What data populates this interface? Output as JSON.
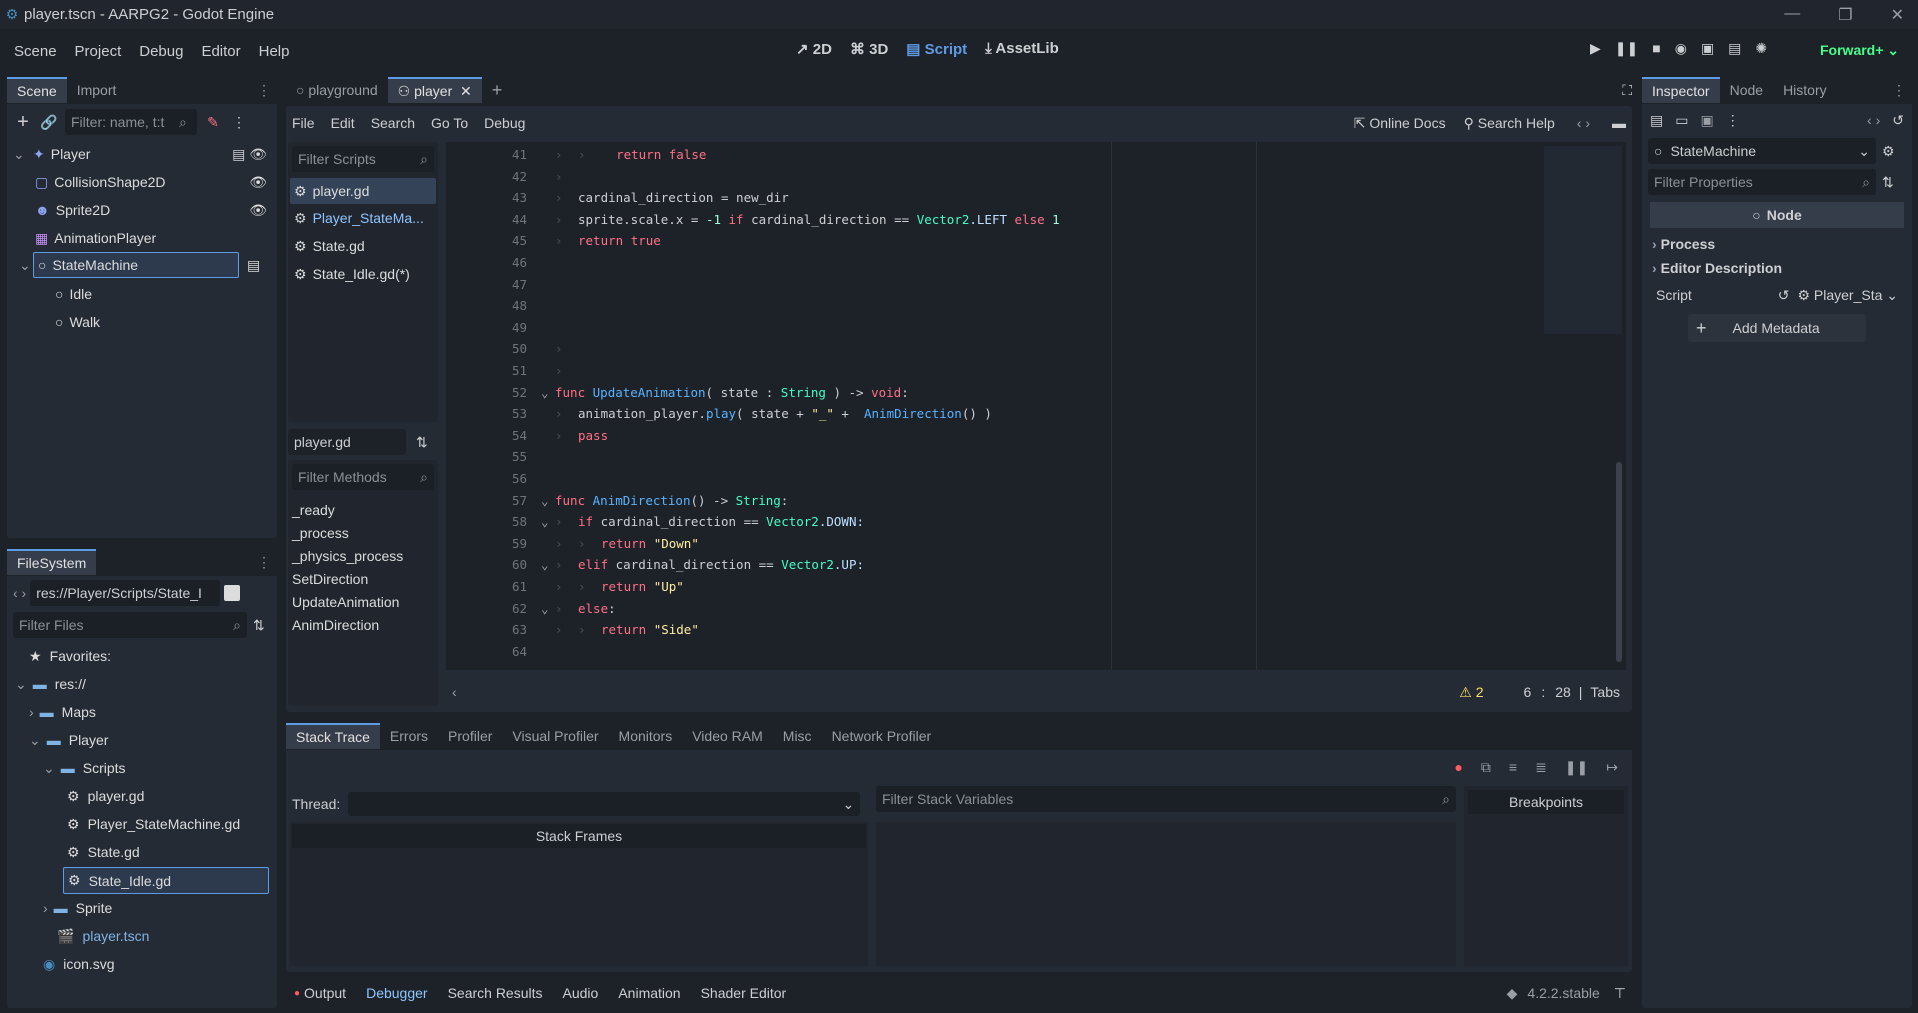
{
  "window": {
    "title": "player.tscn - AARPG2 - Godot Engine"
  },
  "menu": {
    "items": [
      "Scene",
      "Project",
      "Debug",
      "Editor",
      "Help"
    ]
  },
  "workspaces": {
    "items": [
      "2D",
      "3D",
      "Script",
      "AssetLib"
    ],
    "active": "Script"
  },
  "renderer": "Forward+",
  "scene_panel": {
    "tabs": [
      "Scene",
      "Import"
    ],
    "filter_placeholder": "Filter: name, t:t",
    "nodes": [
      {
        "label": "Player",
        "depth": 0
      },
      {
        "label": "CollisionShape2D",
        "depth": 1
      },
      {
        "label": "Sprite2D",
        "depth": 1
      },
      {
        "label": "AnimationPlayer",
        "depth": 1
      },
      {
        "label": "StateMachine",
        "depth": 1
      },
      {
        "label": "Idle",
        "depth": 2
      },
      {
        "label": "Walk",
        "depth": 2
      }
    ]
  },
  "filesystem": {
    "tab": "FileSystem",
    "path": "res://Player/Scripts/State_I",
    "filter_placeholder": "Filter Files",
    "items": [
      {
        "label": "Favorites:",
        "depth": 0
      },
      {
        "label": "res://",
        "depth": 0
      },
      {
        "label": "Maps",
        "depth": 1
      },
      {
        "label": "Player",
        "depth": 1
      },
      {
        "label": "Scripts",
        "depth": 2
      },
      {
        "label": "player.gd",
        "depth": 3
      },
      {
        "label": "Player_StateMachine.gd",
        "depth": 3
      },
      {
        "label": "State.gd",
        "depth": 3
      },
      {
        "label": "State_Idle.gd",
        "depth": 3
      },
      {
        "label": "Sprite",
        "depth": 2
      },
      {
        "label": "player.tscn",
        "depth": 2
      },
      {
        "label": "icon.svg",
        "depth": 1
      }
    ]
  },
  "editor_tabs": {
    "items": [
      "playground",
      "player"
    ],
    "active": "player"
  },
  "script_menu": {
    "items": [
      "File",
      "Edit",
      "Search",
      "Go To",
      "Debug"
    ],
    "online_docs": "Online Docs",
    "search_help": "Search Help"
  },
  "scripts_list": {
    "filter_placeholder": "Filter Scripts",
    "items": [
      "player.gd",
      "Player_StateMa...",
      "State.gd",
      "State_Idle.gd(*)"
    ],
    "current": "player.gd"
  },
  "methods": {
    "filter_placeholder": "Filter Methods",
    "items": [
      "_ready",
      "_process",
      "_physics_process",
      "SetDirection",
      "UpdateAnimation",
      "AnimDirection"
    ]
  },
  "code": {
    "lines": [
      {
        "n": "41",
        "tokens": [
          [
            "  ",
            "tx"
          ],
          [
            "return ",
            "kw"
          ],
          [
            "false",
            "kw"
          ]
        ],
        "indent": 2
      },
      {
        "n": "42",
        "tokens": [],
        "indent": 1
      },
      {
        "n": "43",
        "tokens": [
          [
            "cardinal_direction = new_dir",
            "tx"
          ]
        ],
        "indent": 1
      },
      {
        "n": "44",
        "tokens": [
          [
            "sprite.scale.x = ",
            "tx"
          ],
          [
            "-1",
            "nu"
          ],
          [
            " if ",
            "kw"
          ],
          [
            "cardinal_direction == ",
            "tx"
          ],
          [
            "Vector2",
            "ty"
          ],
          [
            ".LEFT ",
            "mb"
          ],
          [
            "else ",
            "kw"
          ],
          [
            "1",
            "nu"
          ]
        ],
        "indent": 1
      },
      {
        "n": "45",
        "tokens": [
          [
            "return ",
            "kw"
          ],
          [
            "true",
            "kw"
          ]
        ],
        "indent": 1
      },
      {
        "n": "46",
        "tokens": [],
        "indent": 0
      },
      {
        "n": "47",
        "tokens": [],
        "indent": 0
      },
      {
        "n": "48",
        "tokens": [],
        "indent": 0
      },
      {
        "n": "49",
        "tokens": [],
        "indent": 0
      },
      {
        "n": "50",
        "tokens": [],
        "indent": 1
      },
      {
        "n": "51",
        "tokens": [],
        "indent": 1
      },
      {
        "n": "52",
        "tokens": [
          [
            "func ",
            "kw"
          ],
          [
            "UpdateAnimation",
            "fn"
          ],
          [
            "( state : ",
            "tx"
          ],
          [
            "String",
            "ty"
          ],
          [
            " ) -> ",
            "tx"
          ],
          [
            "void",
            "kw"
          ],
          [
            ":",
            "tx"
          ]
        ],
        "indent": 0,
        "fold": true
      },
      {
        "n": "53",
        "tokens": [
          [
            "animation_player.",
            "tx"
          ],
          [
            "play",
            "fn"
          ],
          [
            "( state + ",
            "tx"
          ],
          [
            "\"_\"",
            "st"
          ],
          [
            " +  ",
            "tx"
          ],
          [
            "AnimDirection",
            "fn"
          ],
          [
            "() )",
            "tx"
          ]
        ],
        "indent": 1
      },
      {
        "n": "54",
        "tokens": [
          [
            "pass",
            "kw"
          ]
        ],
        "indent": 1
      },
      {
        "n": "55",
        "tokens": [],
        "indent": 0
      },
      {
        "n": "56",
        "tokens": [],
        "indent": 0
      },
      {
        "n": "57",
        "tokens": [
          [
            "func ",
            "kw"
          ],
          [
            "AnimDirection",
            "fn"
          ],
          [
            "() -> ",
            "tx"
          ],
          [
            "String",
            "ty"
          ],
          [
            ":",
            "tx"
          ]
        ],
        "indent": 0,
        "fold": true
      },
      {
        "n": "58",
        "tokens": [
          [
            "if ",
            "kw"
          ],
          [
            "cardinal_direction == ",
            "tx"
          ],
          [
            "Vector2",
            "ty"
          ],
          [
            ".DOWN:",
            "mb"
          ]
        ],
        "indent": 1,
        "fold": true
      },
      {
        "n": "59",
        "tokens": [
          [
            "return ",
            "kw"
          ],
          [
            "\"Down\"",
            "st"
          ]
        ],
        "indent": 2
      },
      {
        "n": "60",
        "tokens": [
          [
            "elif ",
            "kw"
          ],
          [
            "cardinal_direction == ",
            "tx"
          ],
          [
            "Vector2",
            "ty"
          ],
          [
            ".UP:",
            "mb"
          ]
        ],
        "indent": 1,
        "fold": true
      },
      {
        "n": "61",
        "tokens": [
          [
            "return ",
            "kw"
          ],
          [
            "\"Up\"",
            "st"
          ]
        ],
        "indent": 2
      },
      {
        "n": "62",
        "tokens": [
          [
            "else",
            "kw"
          ],
          [
            ":",
            "tx"
          ]
        ],
        "indent": 1,
        "fold": true
      },
      {
        "n": "63",
        "tokens": [
          [
            "return ",
            "kw"
          ],
          [
            "\"Side\"",
            "st"
          ]
        ],
        "indent": 2
      },
      {
        "n": "64",
        "tokens": [],
        "indent": 0
      }
    ]
  },
  "status": {
    "warnings": "2",
    "line": "6",
    "col": "28",
    "indent_mode": "Tabs"
  },
  "debugger": {
    "tabs": [
      "Stack Trace",
      "Errors",
      "Profiler",
      "Visual Profiler",
      "Monitors",
      "Video RAM",
      "Misc",
      "Network Profiler"
    ],
    "thread_label": "Thread:",
    "filter_vars_placeholder": "Filter Stack Variables",
    "stack_frames": "Stack Frames",
    "breakpoints": "Breakpoints"
  },
  "bottom_bar": {
    "items": [
      "Output",
      "Debugger",
      "Search Results",
      "Audio",
      "Animation",
      "Shader Editor"
    ],
    "active": "Debugger",
    "version": "4.2.2.stable"
  },
  "inspector": {
    "tabs": [
      "Inspector",
      "Node",
      "History"
    ],
    "object": "StateMachine",
    "filter_placeholder": "Filter Properties",
    "section": "Node",
    "groups": [
      "Process",
      "Editor Description"
    ],
    "script_label": "Script",
    "script_value": "Player_Sta",
    "add_metadata": "Add Metadata"
  },
  "colors": {
    "accent": "#5e9be5",
    "bg": "#1d2229",
    "panel": "#252b34",
    "warning": "#ffde66",
    "record": "#ff5d5d"
  }
}
